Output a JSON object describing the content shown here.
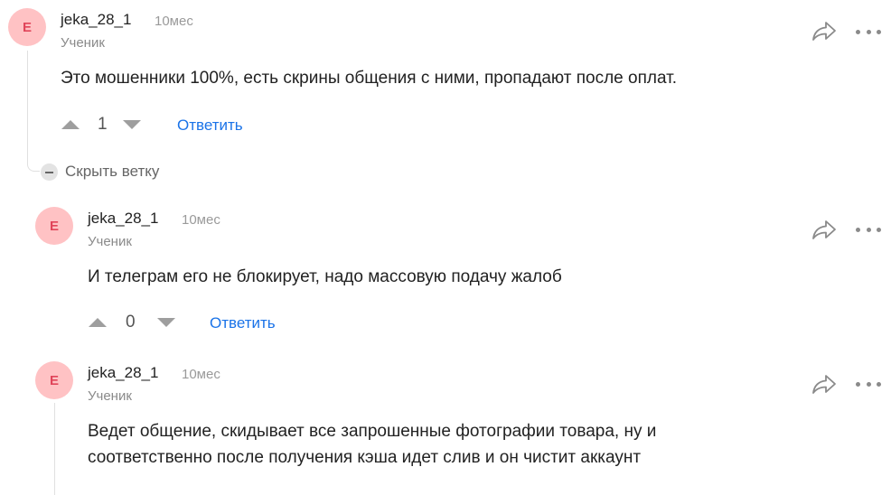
{
  "comments": [
    {
      "avatar_letter": "E",
      "username": "jeka_28_1",
      "time": "10мес",
      "rank": "Ученик",
      "text_lines": [
        "Это мошенники 100%, есть скрины общения с ними, пропадают после оплат."
      ],
      "votes": "1",
      "reply_label": "Ответить"
    },
    {
      "avatar_letter": "E",
      "username": "jeka_28_1",
      "time": "10мес",
      "rank": "Ученик",
      "text_lines": [
        "И телеграм его не блокирует, надо массовую подачу жалоб"
      ],
      "votes": "0",
      "reply_label": "Ответить"
    },
    {
      "avatar_letter": "E",
      "username": "jeka_28_1",
      "time": "10мес",
      "rank": "Ученик",
      "text_lines": [
        "Ведет общение, скидывает все запрошенные фотографии товара, ну и",
        "соответственно после получения кэша идет слив и он чистит аккаунт"
      ]
    }
  ],
  "collapse_label": "Скрыть ветку",
  "icons": {
    "share": "share-icon",
    "more": "more-icon",
    "upvote": "upvote-icon",
    "downvote": "downvote-icon",
    "collapse": "minus-circle-icon"
  },
  "colors": {
    "avatar_bg": "#ffc2c4",
    "avatar_text": "#e0455a",
    "link": "#1a73e8"
  }
}
